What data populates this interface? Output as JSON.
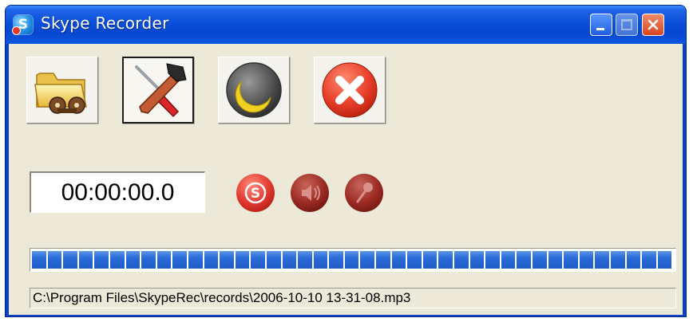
{
  "window": {
    "title": "Skype Recorder",
    "app_icon": "skype-icon",
    "caption_buttons": [
      "minimize",
      "maximize",
      "close"
    ]
  },
  "toolbar": {
    "buttons": [
      {
        "name": "open-records-folder",
        "icon": "folder-with-tape-icon",
        "pressed": false
      },
      {
        "name": "settings",
        "icon": "screwdriver-hammer-icon",
        "pressed": true
      },
      {
        "name": "sleep",
        "icon": "moon-icon",
        "pressed": false
      },
      {
        "name": "exit",
        "icon": "red-x-circle-icon",
        "pressed": false
      }
    ]
  },
  "recording": {
    "timer": "00:00:00.0",
    "indicators": [
      {
        "name": "skype-status",
        "icon": "skype-s-icon",
        "active": true
      },
      {
        "name": "speaker-status",
        "icon": "speaker-icon",
        "active": false
      },
      {
        "name": "microphone-status",
        "icon": "microphone-icon",
        "active": false
      }
    ]
  },
  "progress": {
    "fraction": 1.0
  },
  "file_path": "C:\\Program Files\\SkypeRec\\records\\2006-10-10 13-31-08.mp3",
  "colors": {
    "titlebar": "#0a4fd9",
    "client_bg": "#ece9d8",
    "progress_fill": "#1e5bc8",
    "indicator_active": "#e0382e",
    "indicator_inactive": "#9a2a22"
  }
}
